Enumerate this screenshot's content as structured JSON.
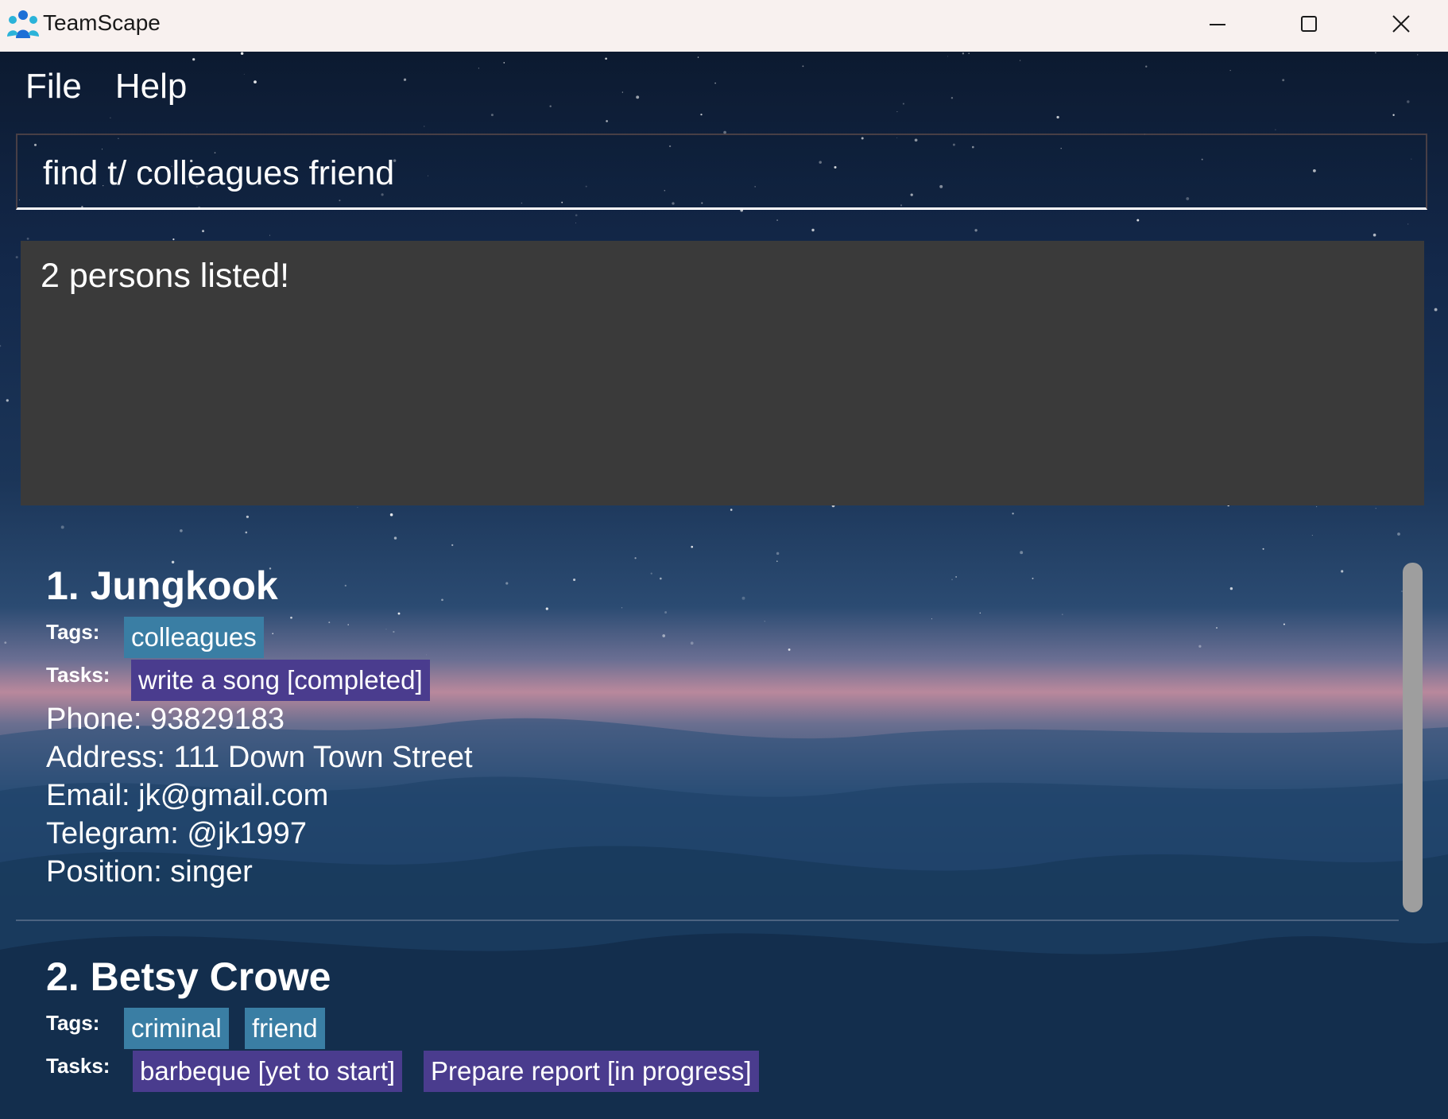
{
  "window": {
    "title": "TeamScape",
    "controls": [
      "minimize-icon",
      "maximize-icon",
      "close-icon"
    ]
  },
  "menu": {
    "items": [
      "File",
      "Help"
    ]
  },
  "command": {
    "value": "find t/ colleagues friend"
  },
  "result": {
    "message": "2 persons listed!"
  },
  "persons": [
    {
      "name": "1. Jungkook",
      "tags_label": "Tags:",
      "tags": [
        "colleagues"
      ],
      "tasks_label": "Tasks:",
      "tasks": [
        "write a song [completed]"
      ],
      "phone": "Phone: 93829183",
      "address": "Address: 111 Down Town Street",
      "email": "Email: jk@gmail.com",
      "telegram": "Telegram: @jk1997",
      "position": "Position: singer"
    },
    {
      "name": "2. Betsy Crowe",
      "tags_label": "Tags:",
      "tags": [
        "criminal",
        "friend"
      ],
      "tasks_label": "Tasks:",
      "tasks": [
        "barbeque [yet to start]",
        "Prepare report [in progress]"
      ]
    }
  ],
  "colors": {
    "titlebar": "#f8f1ef",
    "result_box": "#3a3a3a",
    "tag_chip": "#3a7ea4",
    "task_chip": "#4a3c8e",
    "scrollbar": "#9e9e9e"
  }
}
